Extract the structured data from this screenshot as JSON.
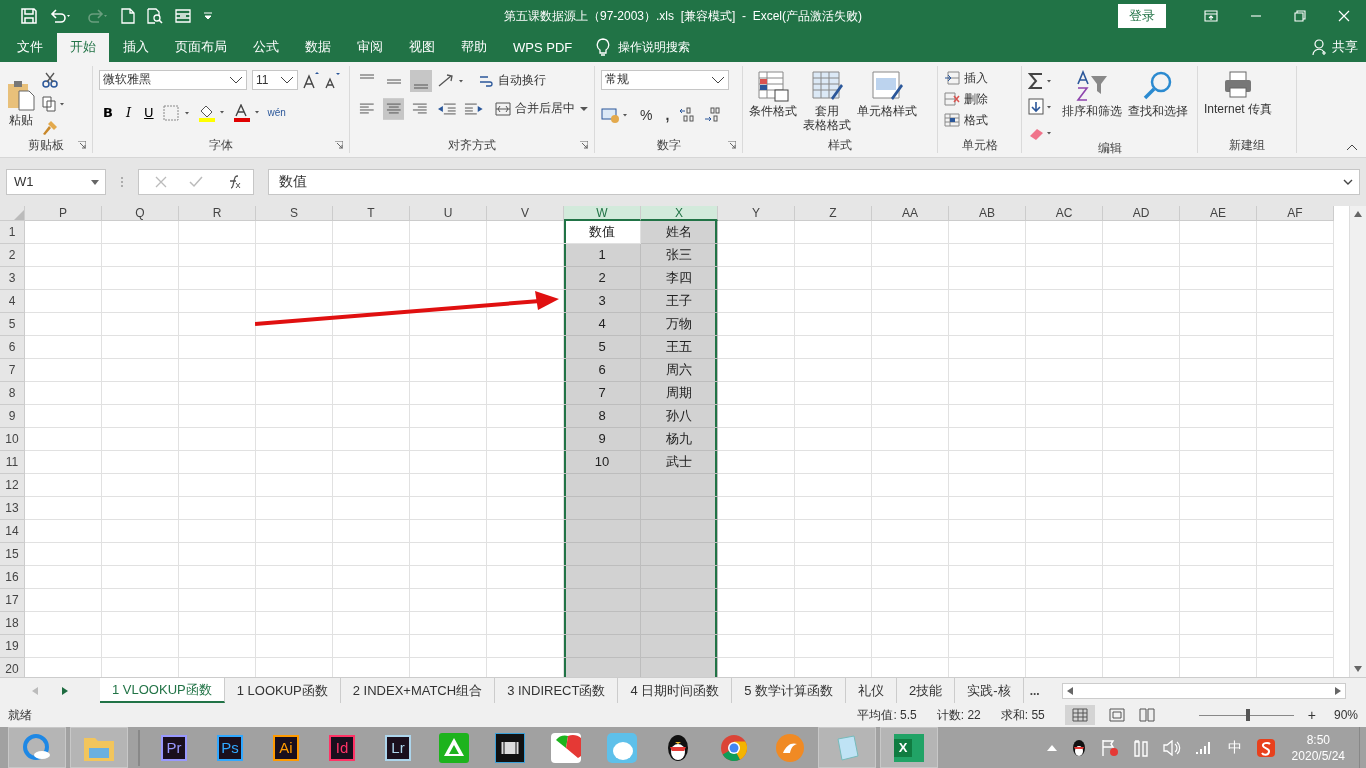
{
  "title_bar": {
    "title": "第五课数据源上（97-2003）.xls  [兼容模式]  -  Excel(产品激活失败)",
    "login_button": "登录"
  },
  "ribbon_tabs": [
    {
      "label": "文件",
      "selected": false
    },
    {
      "label": "开始",
      "selected": true
    },
    {
      "label": "插入",
      "selected": false
    },
    {
      "label": "页面布局",
      "selected": false
    },
    {
      "label": "公式",
      "selected": false
    },
    {
      "label": "数据",
      "selected": false
    },
    {
      "label": "审阅",
      "selected": false
    },
    {
      "label": "视图",
      "selected": false
    },
    {
      "label": "帮助",
      "selected": false
    },
    {
      "label": "WPS PDF",
      "selected": false
    }
  ],
  "tell_me": "操作说明搜索",
  "share": "共享",
  "ribbon": {
    "clipboard": {
      "label": "剪贴板",
      "paste": "粘贴"
    },
    "font": {
      "label": "字体",
      "font_name": "微软雅黑",
      "font_size": "11",
      "bold": "B",
      "italic": "I",
      "underline": "U",
      "phonetic": "wén"
    },
    "alignment": {
      "label": "对齐方式",
      "wrap_text": "自动换行",
      "merge_center": "合并后居中"
    },
    "number": {
      "label": "数字",
      "format": "常规",
      "percent": "%",
      "comma": ","
    },
    "styles": {
      "label": "样式",
      "conditional": "条件格式",
      "table_line1": "套用",
      "table_line2": "表格格式",
      "cell_styles": "单元格样式"
    },
    "cells": {
      "label": "单元格",
      "insert": "插入",
      "delete": "删除",
      "format": "格式"
    },
    "editing": {
      "label": "编辑",
      "sort_filter": "排序和筛选",
      "find_select": "查找和选择"
    },
    "new_group": {
      "label": "新建组",
      "fax": "Internet 传真"
    }
  },
  "formula_bar": {
    "name_box": "W1",
    "formula": "数值"
  },
  "sheet": {
    "columns": [
      {
        "label": "P",
        "selected": false
      },
      {
        "label": "Q",
        "selected": false
      },
      {
        "label": "R",
        "selected": false
      },
      {
        "label": "S",
        "selected": false
      },
      {
        "label": "T",
        "selected": false
      },
      {
        "label": "U",
        "selected": false
      },
      {
        "label": "V",
        "selected": false
      },
      {
        "label": "W",
        "selected": true
      },
      {
        "label": "X",
        "selected": true
      },
      {
        "label": "Y",
        "selected": false
      },
      {
        "label": "Z",
        "selected": false
      },
      {
        "label": "AA",
        "selected": false
      },
      {
        "label": "AB",
        "selected": false
      },
      {
        "label": "AC",
        "selected": false
      },
      {
        "label": "AD",
        "selected": false
      },
      {
        "label": "AE",
        "selected": false
      },
      {
        "label": "AF",
        "selected": false
      }
    ],
    "rows": [
      {
        "number": "1",
        "values": {
          "W": {
            "text": "数值",
            "active": true
          },
          "X": {
            "text": "姓名",
            "active": false
          }
        }
      },
      {
        "number": "2",
        "values": {
          "W": {
            "text": "1",
            "active": false
          },
          "X": {
            "text": "张三",
            "active": false
          }
        }
      },
      {
        "number": "3",
        "values": {
          "W": {
            "text": "2",
            "active": false
          },
          "X": {
            "text": "李四",
            "active": false
          }
        }
      },
      {
        "number": "4",
        "values": {
          "W": {
            "text": "3",
            "active": false
          },
          "X": {
            "text": "王子",
            "active": false
          }
        }
      },
      {
        "number": "5",
        "values": {
          "W": {
            "text": "4",
            "active": false
          },
          "X": {
            "text": "万物",
            "active": false
          }
        }
      },
      {
        "number": "6",
        "values": {
          "W": {
            "text": "5",
            "active": false
          },
          "X": {
            "text": "王五",
            "active": false
          }
        }
      },
      {
        "number": "7",
        "values": {
          "W": {
            "text": "6",
            "active": false
          },
          "X": {
            "text": "周六",
            "active": false
          }
        }
      },
      {
        "number": "8",
        "values": {
          "W": {
            "text": "7",
            "active": false
          },
          "X": {
            "text": "周期",
            "active": false
          }
        }
      },
      {
        "number": "9",
        "values": {
          "W": {
            "text": "8",
            "active": false
          },
          "X": {
            "text": "孙八",
            "active": false
          }
        }
      },
      {
        "number": "10",
        "values": {
          "W": {
            "text": "9",
            "active": false
          },
          "X": {
            "text": "杨九",
            "active": false
          }
        }
      },
      {
        "number": "11",
        "values": {
          "W": {
            "text": "10",
            "active": false
          },
          "X": {
            "text": "武士",
            "active": false
          }
        }
      },
      {
        "number": "12"
      },
      {
        "number": "13"
      },
      {
        "number": "14"
      },
      {
        "number": "15"
      },
      {
        "number": "16"
      },
      {
        "number": "17"
      },
      {
        "number": "18"
      },
      {
        "number": "19"
      },
      {
        "number": "20"
      }
    ]
  },
  "sheet_tabs": [
    {
      "label": "1 VLOOKUP函数",
      "selected": true
    },
    {
      "label": "1 LOOKUP函数",
      "selected": false
    },
    {
      "label": "2 INDEX+MATCH组合",
      "selected": false
    },
    {
      "label": "3 INDIRECT函数",
      "selected": false
    },
    {
      "label": "4 日期时间函数",
      "selected": false
    },
    {
      "label": "5 数学计算函数",
      "selected": false
    },
    {
      "label": "礼仪",
      "selected": false
    },
    {
      "label": "2技能",
      "selected": false
    },
    {
      "label": "实践-核",
      "selected": false
    }
  ],
  "more_tabs": "...",
  "status_bar": {
    "status": "就绪",
    "average": "平均值: 5.5",
    "count": "计数: 22",
    "sum": "求和: 55",
    "zoom_in": "+",
    "zoom": "90%",
    "zoom_slider": {
      "level": 0.5
    }
  },
  "taskbar": {
    "apps": [
      {
        "label": "Pr",
        "color": "#9999ff"
      },
      {
        "label": "Ps",
        "color": "#31a8ff"
      },
      {
        "label": "Ai",
        "color": "#ff9a00"
      },
      {
        "label": "Id",
        "color": "#ff3366"
      },
      {
        "label": "Lr",
        "color": "#add5ec"
      }
    ],
    "excel_label": "X",
    "ime": "中",
    "time": "8:50",
    "date": "2020/5/24"
  }
}
